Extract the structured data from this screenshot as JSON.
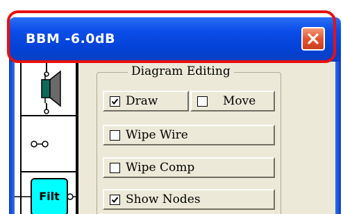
{
  "window": {
    "title": "BBM -6.0dB"
  },
  "palette": {
    "items": [
      {
        "name": "speaker-component",
        "label": ""
      },
      {
        "name": "wire-component",
        "label": ""
      },
      {
        "name": "filter-component",
        "label": "Filt"
      }
    ]
  },
  "diagram_editing": {
    "group_label": "Diagram Editing",
    "draw": {
      "label": "Draw",
      "checked": true
    },
    "move": {
      "label": "Move",
      "checked": false
    },
    "wipe_wire": {
      "label": "Wipe Wire",
      "checked": false
    },
    "wipe_comp": {
      "label": "Wipe Comp",
      "checked": false
    },
    "show_nodes": {
      "label": "Show Nodes",
      "checked": true
    }
  },
  "colors": {
    "title_bar": "#0b4de8",
    "highlight": "#e81010",
    "close_button": "#e3552f",
    "filter_fill": "#00ffff",
    "dialog_bg": "#ece9d8"
  }
}
